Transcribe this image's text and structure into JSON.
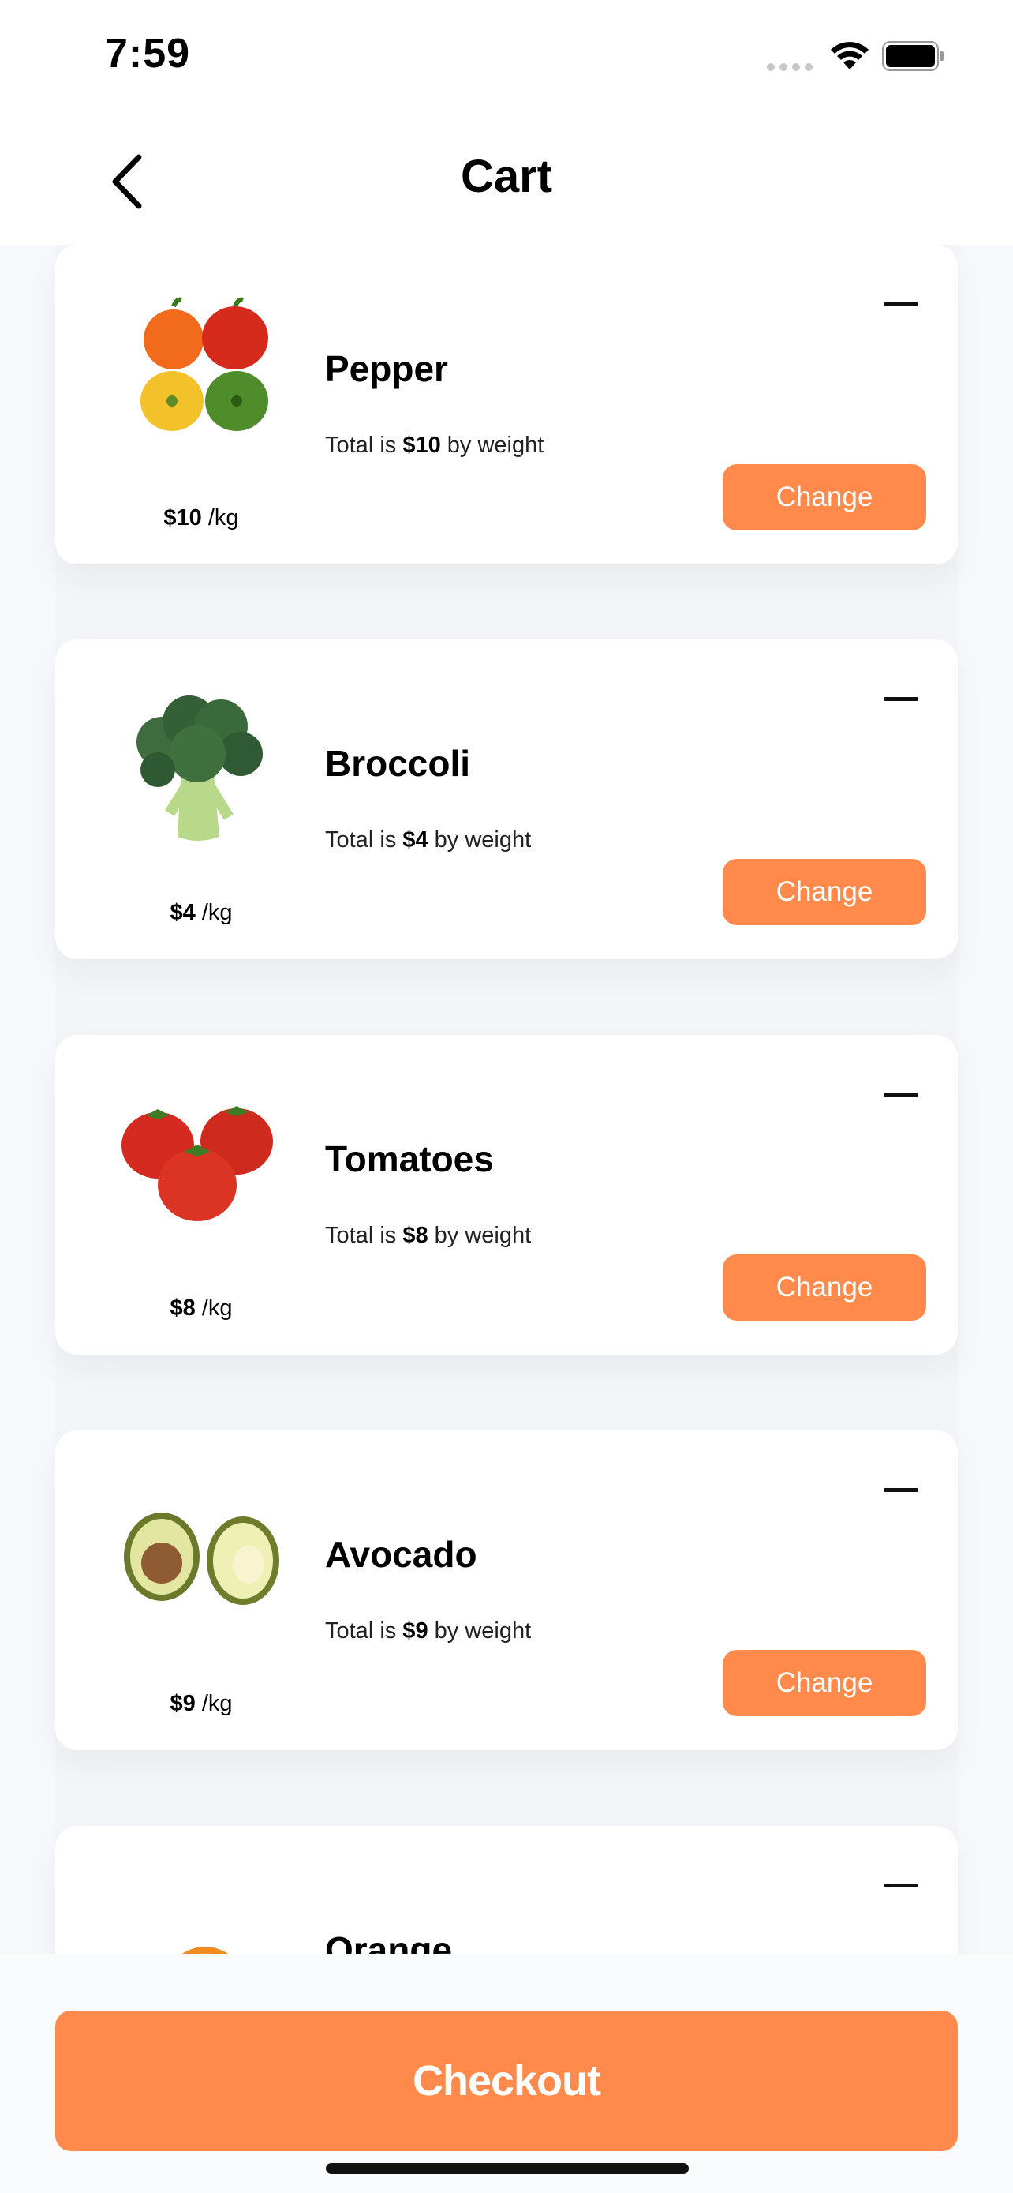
{
  "status_bar": {
    "time": "7:59",
    "icons": [
      "signal-icon",
      "wifi-icon",
      "battery-icon"
    ]
  },
  "header": {
    "title": "Cart",
    "back_icon": "chevron-left-icon"
  },
  "cart": {
    "items": [
      {
        "name": "Pepper",
        "total_prefix": "Total is",
        "total": "$10",
        "total_suffix": "by weight",
        "price": "$10",
        "unit": "/kg",
        "change_label": "Change",
        "image_icon": "pepper-image"
      },
      {
        "name": "Broccoli",
        "total_prefix": "Total is",
        "total": "$4",
        "total_suffix": "by weight",
        "price": "$4",
        "unit": "/kg",
        "change_label": "Change",
        "image_icon": "broccoli-image"
      },
      {
        "name": "Tomatoes",
        "total_prefix": "Total is",
        "total": "$8",
        "total_suffix": "by weight",
        "price": "$8",
        "unit": "/kg",
        "change_label": "Change",
        "image_icon": "tomatoes-image"
      },
      {
        "name": "Avocado",
        "total_prefix": "Total is",
        "total": "$9",
        "total_suffix": "by weight",
        "price": "$9",
        "unit": "/kg",
        "change_label": "Change",
        "image_icon": "avocado-image"
      },
      {
        "name": "Orange",
        "image_icon": "orange-image"
      }
    ]
  },
  "footer": {
    "checkout_label": "Checkout"
  },
  "colors": {
    "accent": "#ff8a4c",
    "background": "#fafbfd",
    "card": "#ffffff",
    "text": "#000000"
  }
}
